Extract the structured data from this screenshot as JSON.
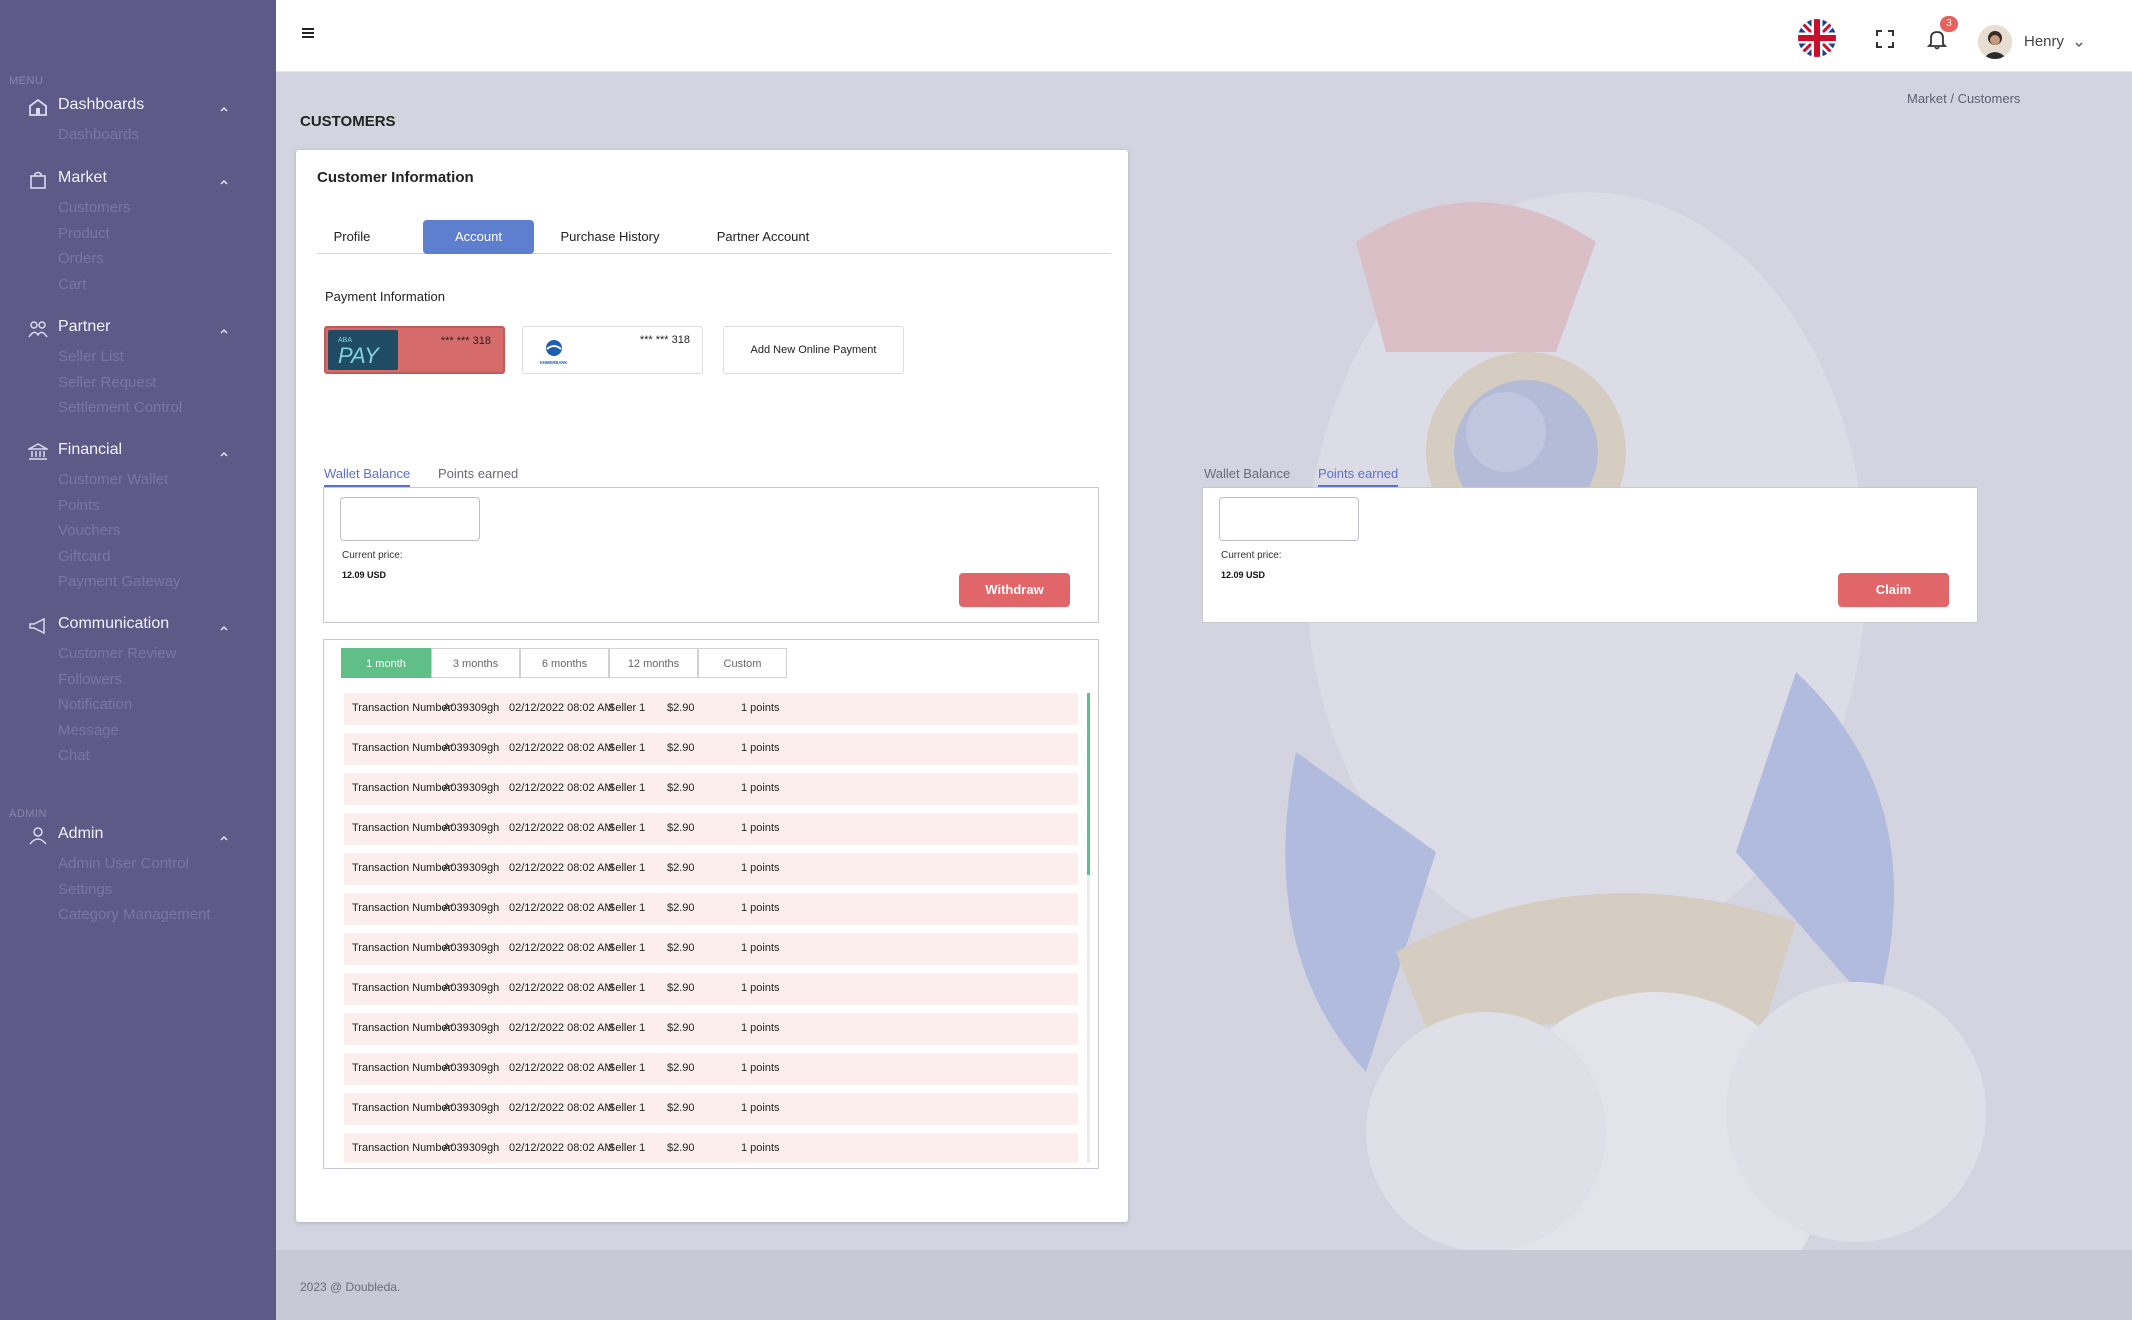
{
  "sidebar": {
    "menu_label": "MENU",
    "admin_label": "ADMIN",
    "groups": [
      {
        "label": "Dashboards",
        "items": [
          "Dashboards"
        ]
      },
      {
        "label": "Market",
        "items": [
          "Customers",
          "Product",
          "Orders",
          "Cart"
        ]
      },
      {
        "label": "Partner",
        "items": [
          "Seller List",
          "Seller Request",
          "Settlement Control"
        ]
      },
      {
        "label": "Financial",
        "items": [
          "Customer Wallet",
          "Points",
          "Vouchers",
          "Giftcard",
          "Payment Gateway"
        ]
      },
      {
        "label": "Communication",
        "items": [
          "Customer Review",
          "Followers",
          "Notification",
          "Message",
          "Chat"
        ]
      },
      {
        "label": "Admin",
        "items": [
          "Admin User Control",
          "Settings",
          "Category Management"
        ]
      }
    ]
  },
  "topbar": {
    "notification_count": "3",
    "user_name": "Henry"
  },
  "breadcrumb": "Market / Customers",
  "page_title": "CUSTOMERS",
  "card": {
    "title": "Customer Information",
    "tabs": [
      {
        "label": "Profile",
        "active": false
      },
      {
        "label": "Account",
        "active": true
      },
      {
        "label": "Purchase History",
        "active": false
      },
      {
        "label": "Partner Account",
        "active": false
      }
    ],
    "payment_title": "Payment Information",
    "aba_card": {
      "logo_top": "ABA",
      "logo_main": "PAY",
      "number": "*** *** 318"
    },
    "bank_card": {
      "logo_text": "KHMERBANK",
      "number": "*** *** 318"
    },
    "add_new_label": "Add New Online Payment"
  },
  "left_panel": {
    "tab_wallet": "Wallet Balance",
    "tab_points": "Points earned",
    "active_tab": "Wallet Balance",
    "input_value": "",
    "current_price_label": "Current price:",
    "current_price_value": "12.09 USD",
    "action_label": "Withdraw"
  },
  "right_panel": {
    "tab_wallet": "Wallet Balance",
    "tab_points": "Points earned",
    "active_tab": "Points earned",
    "input_value": "",
    "current_price_label": "Current price:",
    "current_price_value": "12.09 USD",
    "action_label": "Claim"
  },
  "periods": [
    {
      "label": "1 month",
      "active": true
    },
    {
      "label": "3 months",
      "active": false
    },
    {
      "label": "6 months",
      "active": false
    },
    {
      "label": "12 months",
      "active": false
    },
    {
      "label": "Custom",
      "active": false
    }
  ],
  "transactions": [
    {
      "label": "Transaction Number:",
      "id": "A039309gh",
      "date": "02/12/2022 08:02 AM",
      "seller": "Seller 1",
      "amount": "$2.90",
      "points": "1 points"
    },
    {
      "label": "Transaction Number:",
      "id": "A039309gh",
      "date": "02/12/2022 08:02 AM",
      "seller": "Seller 1",
      "amount": "$2.90",
      "points": "1 points"
    },
    {
      "label": "Transaction Number:",
      "id": "A039309gh",
      "date": "02/12/2022 08:02 AM",
      "seller": "Seller 1",
      "amount": "$2.90",
      "points": "1 points"
    },
    {
      "label": "Transaction Number:",
      "id": "A039309gh",
      "date": "02/12/2022 08:02 AM",
      "seller": "Seller 1",
      "amount": "$2.90",
      "points": "1 points"
    },
    {
      "label": "Transaction Number:",
      "id": "A039309gh",
      "date": "02/12/2022 08:02 AM",
      "seller": "Seller 1",
      "amount": "$2.90",
      "points": "1 points"
    },
    {
      "label": "Transaction Number:",
      "id": "A039309gh",
      "date": "02/12/2022 08:02 AM",
      "seller": "Seller 1",
      "amount": "$2.90",
      "points": "1 points"
    },
    {
      "label": "Transaction Number:",
      "id": "A039309gh",
      "date": "02/12/2022 08:02 AM",
      "seller": "Seller 1",
      "amount": "$2.90",
      "points": "1 points"
    },
    {
      "label": "Transaction Number:",
      "id": "A039309gh",
      "date": "02/12/2022 08:02 AM",
      "seller": "Seller 1",
      "amount": "$2.90",
      "points": "1 points"
    },
    {
      "label": "Transaction Number:",
      "id": "A039309gh",
      "date": "02/12/2022 08:02 AM",
      "seller": "Seller 1",
      "amount": "$2.90",
      "points": "1 points"
    },
    {
      "label": "Transaction Number:",
      "id": "A039309gh",
      "date": "02/12/2022 08:02 AM",
      "seller": "Seller 1",
      "amount": "$2.90",
      "points": "1 points"
    },
    {
      "label": "Transaction Number:",
      "id": "A039309gh",
      "date": "02/12/2022 08:02 AM",
      "seller": "Seller 1",
      "amount": "$2.90",
      "points": "1 points"
    },
    {
      "label": "Transaction Number:",
      "id": "A039309gh",
      "date": "02/12/2022 08:02 AM",
      "seller": "Seller 1",
      "amount": "$2.90",
      "points": "1 points"
    }
  ],
  "footer": "2023 @ Doubleda.",
  "colors": {
    "sidebar_bg": "#5e5a88",
    "primary_blue": "#5e7fce",
    "danger_red": "#e0666a",
    "success_green": "#5fbf86"
  }
}
